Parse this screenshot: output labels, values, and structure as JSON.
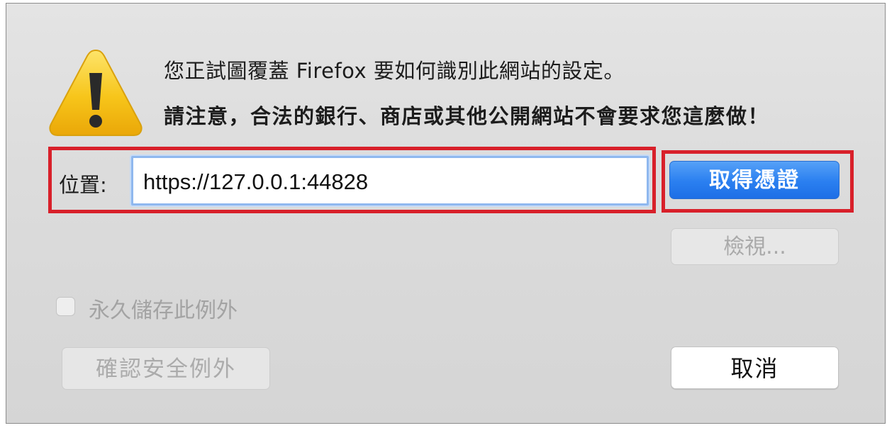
{
  "dialog": {
    "message_line1": "您正試圖覆蓋 Firefox 要如何識別此網站的設定。",
    "message_line2": "請注意，合法的銀行、商店或其他公開網站不會要求您這麼做！",
    "warning_icon": "warning-triangle-icon"
  },
  "location": {
    "label": "位置:",
    "value": "https://127.0.0.1:44828"
  },
  "buttons": {
    "get_certificate": "取得憑證",
    "view": "檢視...",
    "confirm_exception": "確認安全例外",
    "cancel": "取消"
  },
  "checkbox": {
    "label": "永久儲存此例外",
    "checked": false
  },
  "colors": {
    "highlight": "#d8202a",
    "primary_button": "#2a7ff0",
    "warning_yellow": "#f5c316"
  }
}
